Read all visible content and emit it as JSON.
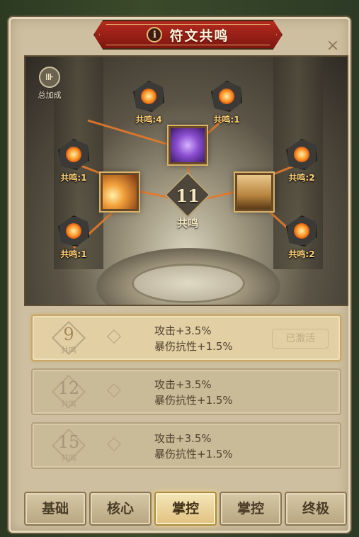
{
  "title": "符文共鸣",
  "icons": {
    "info": "info-icon",
    "close": "close-icon",
    "total": "total-bonus-icon"
  },
  "close_label": "×",
  "total_bonus": {
    "label": "总加成"
  },
  "center": {
    "value": "11",
    "label": "共鸣"
  },
  "runes": [
    {
      "id": "top-left",
      "label": "共鸣:4"
    },
    {
      "id": "top-right",
      "label": "共鸣:1"
    },
    {
      "id": "mid-left",
      "label": "共鸣:1"
    },
    {
      "id": "mid-right",
      "label": "共鸣:2"
    },
    {
      "id": "low-left",
      "label": "共鸣:1"
    },
    {
      "id": "low-right",
      "label": "共鸣:2"
    }
  ],
  "skills": [
    {
      "id": "purple",
      "name": "purple-skill-icon"
    },
    {
      "id": "orange",
      "name": "orange-skill-icon"
    },
    {
      "id": "tan",
      "name": "tan-skill-icon"
    }
  ],
  "bonuses": [
    {
      "threshold": "9",
      "threshold_label": "共鸣",
      "lines": [
        "攻击+3.5%",
        "暴伤抗性+1.5%"
      ],
      "status": "已激活",
      "active": true
    },
    {
      "threshold": "12",
      "threshold_label": "共鸣",
      "lines": [
        "攻击+3.5%",
        "暴伤抗性+1.5%"
      ],
      "status": "",
      "active": false
    },
    {
      "threshold": "15",
      "threshold_label": "共鸣",
      "lines": [
        "攻击+3.5%",
        "暴伤抗性+1.5%"
      ],
      "status": "",
      "active": false
    }
  ],
  "tabs": [
    {
      "label": "基础",
      "active": false
    },
    {
      "label": "核心",
      "active": false
    },
    {
      "label": "掌控",
      "active": true
    },
    {
      "label": "掌控",
      "active": false
    },
    {
      "label": "终极",
      "active": false
    }
  ],
  "colors": {
    "banner": "#b42a1e",
    "rune_glow": "#f07a1c",
    "active_tab": "#e1c27f"
  }
}
